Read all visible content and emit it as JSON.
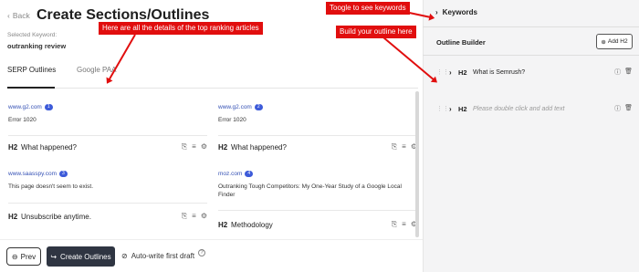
{
  "header": {
    "back_label": "Back",
    "title": "Create Sections/Outlines",
    "keyword_label": "Selected Keyword:",
    "keyword_value": "outranking review"
  },
  "callouts": {
    "articles": "Here are all the details of the top ranking articles",
    "keywords": "Toogle to see keywords",
    "outline": "Build your outline here"
  },
  "tabs": [
    {
      "label": "SERP Outlines",
      "active": true
    },
    {
      "label": "Google PAA",
      "active": false
    }
  ],
  "cards": [
    {
      "source": "www.g2.com",
      "rank": "1",
      "description": "Error 1020",
      "h2": "What happened?"
    },
    {
      "source": "www.g2.com",
      "rank": "2",
      "description": "Error 1020",
      "h2": "What happened?"
    },
    {
      "source": "www.saasspy.com",
      "rank": "3",
      "description": "This page doesn't seem to exist.",
      "h2": "Unsubscribe anytime."
    },
    {
      "source": "moz.com",
      "rank": "4",
      "description": "Outranking Tough Competitors: My One-Year Study of a Google Local Finder",
      "h2": "Methodology"
    }
  ],
  "h2_tag": "H2",
  "footer": {
    "prev_label": "Prev",
    "create_label": "Create Outlines",
    "autowrite_label": "Auto-write first draft",
    "help_glyph": "?"
  },
  "right": {
    "keywords_label": "Keywords",
    "outline_builder_label": "Outline Builder",
    "add_h2_label": "Add H2",
    "rows": [
      {
        "tag": "H2",
        "text": "What is Semrush?",
        "placeholder": false
      },
      {
        "tag": "H2",
        "text": "Please double click and add text",
        "placeholder": true
      }
    ]
  },
  "icons": {
    "back": "‹",
    "chevron": "›",
    "plus": "⊕",
    "prev": "⊖",
    "create": "↪",
    "check": "⊘",
    "card_actions": [
      "⎘",
      "≡",
      "⚙"
    ],
    "row_actions": [
      "ⓘ",
      "🗑"
    ]
  },
  "colors": {
    "callout": "#e10e0e",
    "create_button": "#2f3542",
    "link": "#3551b5",
    "badge": "#3d5bd9",
    "panel": "#f4f4f5"
  }
}
